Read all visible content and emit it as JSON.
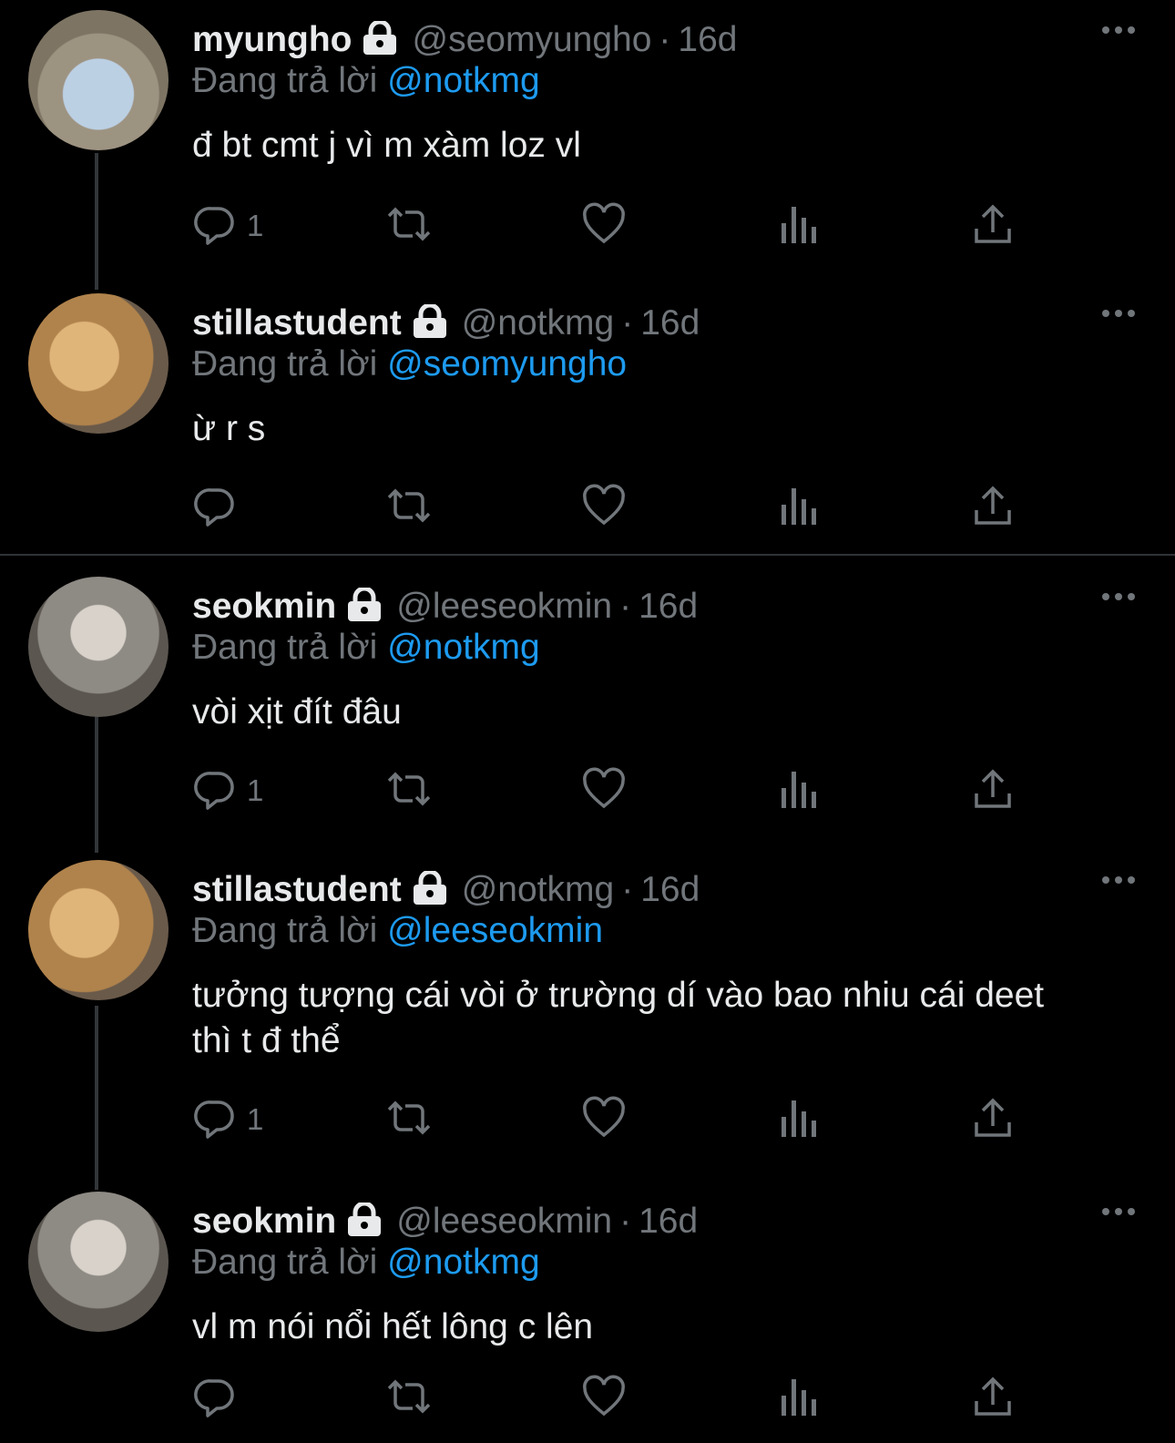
{
  "labels": {
    "replying_to": "Đang trả lời",
    "dot": "·"
  },
  "tweets": [
    {
      "name": "myungho",
      "handle": "@seomyungho",
      "time": "16d",
      "reply_to": "@notkmg",
      "text": "đ bt cmt j vì m xàm loz vl",
      "reply_count": "1"
    },
    {
      "name": "stillastudent",
      "handle": "@notkmg",
      "time": "16d",
      "reply_to": "@seomyungho",
      "text": "ừ r s",
      "reply_count": ""
    },
    {
      "name": "seokmin",
      "handle": "@leeseokmin",
      "time": "16d",
      "reply_to": "@notkmg",
      "text": "vòi xịt đít đâu",
      "reply_count": "1"
    },
    {
      "name": "stillastudent",
      "handle": "@notkmg",
      "time": "16d",
      "reply_to": "@leeseokmin",
      "text": "tưởng tượng cái vòi ở trường dí vào bao nhiu cái deet thì t đ thể",
      "reply_count": "1"
    },
    {
      "name": "seokmin",
      "handle": "@leeseokmin",
      "time": "16d",
      "reply_to": "@notkmg",
      "text": "vl m nói nổi hết lông c lên",
      "reply_count": ""
    }
  ],
  "icons": {
    "lock": "lock-icon",
    "more": "more-icon",
    "reply": "reply-icon",
    "retweet": "retweet-icon",
    "like": "heart-icon",
    "views": "views-icon",
    "share": "share-icon"
  },
  "colors": {
    "background": "#000000",
    "text": "#e7e9ea",
    "muted": "#71767b",
    "accent": "#1d9bf0"
  }
}
